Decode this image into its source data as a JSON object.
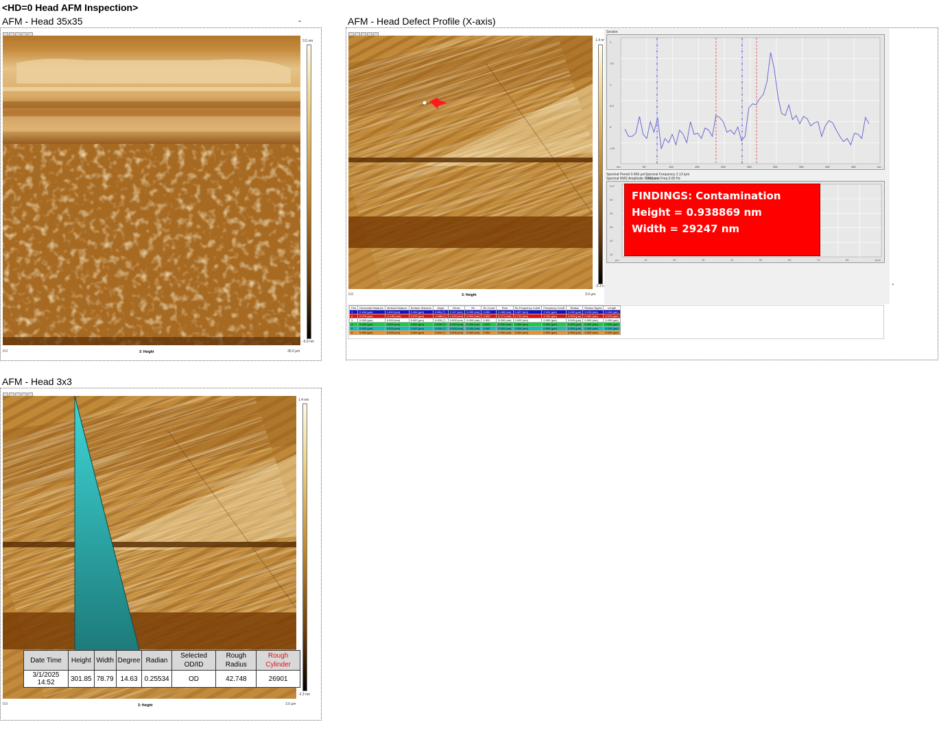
{
  "page_title": "<HD=0 Head AFM Inspection>",
  "panels": {
    "head35": {
      "title": "AFM - Head 35x35",
      "dash_mark": "-",
      "scale_top": "3.5 nm",
      "scale_bottom": "-6.9 nm",
      "x_start": "0.0",
      "x_end": "35.0 µm",
      "x_label": "3: Height"
    },
    "defect": {
      "title": "AFM - Head Defect Profile (X-axis)",
      "scale_top": "1.4 nm",
      "scale_bottom": "-2.3 nm",
      "x_start": "0.0",
      "x_end": "3.0 µm",
      "x_label": "3: Height",
      "section_label": "Section",
      "spectral_period": "Spectral Period  0.469 µm",
      "spectral_freq": "Spectral Frequency  2.13 /µm",
      "spectral_rms": "Spectral RMS Amplitude  0.267 nm",
      "temporal_freq": "Temporal Freq  0.00 Hz",
      "y_ticks": [
        "1",
        "1.5",
        "1",
        "0.5",
        "0",
        "-0.5"
      ],
      "x_ticks": [
        "nm",
        "50",
        "100",
        "150",
        "200",
        "250",
        "300",
        "350",
        "400",
        "450",
        "nm"
      ],
      "psd_x_ticks": [
        "µm",
        "10",
        "20",
        "30",
        "40",
        "50",
        "60",
        "70",
        "80",
        "1/µm"
      ],
      "psd_y_ticks": [
        "nm²",
        "50",
        "40",
        "30",
        "20",
        "10"
      ],
      "profile_y": [
        -0.35,
        -0.7,
        -0.7,
        -0.55,
        0.25,
        -0.6,
        -0.8,
        0.0,
        -0.5,
        0.2,
        -1.3,
        -0.8,
        -1.0,
        -0.6,
        -1.1,
        -0.4,
        -0.6,
        -1.0,
        0.0,
        -0.6,
        -0.55,
        -0.8,
        -0.3,
        -0.4,
        -0.7,
        0.3,
        0.2,
        0.0,
        -0.5,
        -0.4,
        -0.6,
        -0.25,
        -0.9,
        -0.7,
        0.65,
        0.85,
        0.8,
        1.1,
        1.3,
        1.9,
        3.3,
        2.5,
        1.2,
        0.4,
        0.3,
        0.8,
        0.1,
        0.3,
        -0.1,
        0.25,
        0.15,
        -0.2,
        -0.05,
        0.0,
        -0.7,
        -0.2,
        0.05,
        -0.05,
        -0.4,
        -0.7,
        -0.95,
        -0.8,
        -1.1,
        -0.55,
        -0.6,
        -0.8,
        0.2,
        -0.1
      ],
      "findings": {
        "line1": "FINDINGS: Contamination",
        "line2": "Height = 0.938869 nm",
        "line3": "Width = 29247 nm"
      },
      "table_headers": [
        "Pair",
        "Horizontal Distance",
        "Vertical Distance",
        "Surface Distance",
        "Angle",
        "Rmax",
        "Rz",
        "Rz Count",
        "Rms",
        "Ra Frequency Cutoff",
        "Frequency Cutoff",
        "Radius",
        "Radius Sigma",
        "Length"
      ],
      "table_rows": [
        [
          "1",
          "0.164 (µm)",
          "1.610 (nm)",
          "0.164 (µm)",
          "0.564 (°)",
          "2.117 (nm)",
          "0.000 (nm)",
          "0.000",
          "0.168 (nm)",
          "0.407 (nm)",
          "2.131 (µm)",
          "2.492 (µm)",
          "0.215 (nm)",
          "0.164 (µm)"
        ],
        [
          "2",
          "0.076 (µm)",
          "-0.105 (nm)",
          "0.076 (µm)",
          "-0.586 (°)",
          "1.020 (nm)",
          "0.000 (nm)",
          "0.000",
          "0.171 (nm)",
          "0.712 (nm)",
          "2.131 (µm)",
          "0.393 (µm)",
          "0.181 (nm)",
          "0.076 (µm)"
        ],
        [
          "3",
          "0.000 (µm)",
          "0.000 (nm)",
          "0.000 (µm)",
          "0.000 (°)",
          "0.000 (nm)",
          "0.000 (nm)",
          "0.000",
          "0.000 (nm)",
          "0.000 (nm)",
          "0.000 (µm)",
          "0.000 (µm)",
          "0.000 (nm)",
          "0.000 (µm)"
        ],
        [
          "4",
          "0.000 (µm)",
          "0.000 (nm)",
          "0.000 (µm)",
          "0.000 (°)",
          "0.000 (nm)",
          "0.000 (nm)",
          "0.000",
          "0.000 (nm)",
          "0.000 (nm)",
          "0.000 (µm)",
          "0.000 (µm)",
          "0.000 (nm)",
          "0.000 (µm)"
        ],
        [
          "5",
          "0.000 (µm)",
          "0.000 (nm)",
          "0.000 (µm)",
          "0.000 (°)",
          "0.000 (nm)",
          "0.000 (nm)",
          "0.000",
          "0.000 (nm)",
          "0.000 (nm)",
          "0.000 (µm)",
          "0.000 (µm)",
          "0.000 (nm)",
          "0.000 (µm)"
        ],
        [
          "6",
          "0.000 (µm)",
          "0.000 (nm)",
          "0.000 (µm)",
          "0.000 (°)",
          "0.000 (nm)",
          "0.000 (nm)",
          "0.000",
          "0.000 (nm)",
          "0.000 (nm)",
          "0.000 (µm)",
          "0.000 (µm)",
          "0.000 (nm)",
          "0.000 (µm)"
        ]
      ],
      "row_colors": [
        "#1010c8",
        "#e01010",
        "#ffffff",
        "#10d040",
        "#10c0c0",
        "#f09020"
      ],
      "right_dash": "-"
    },
    "head3": {
      "title": "AFM - Head 3x3",
      "scale_top": "1.4 nm",
      "scale_bottom": "-2.3 nm",
      "x_start": "0.0",
      "x_end": "3.0 µm",
      "x_label": "3: Height",
      "measure_headers": [
        "Date Time",
        "Height",
        "Width",
        "Degree",
        "Radian",
        "Selected OD/ID",
        "Rough Radius",
        "Rough Cylinder"
      ],
      "measure_values": [
        "3/1/2025 14:52",
        "301.85",
        "78.79",
        "14.63",
        "0.25534",
        "OD",
        "42.748",
        "26901"
      ]
    }
  },
  "colors": {
    "afm_light": "#f2d79a",
    "afm_mid": "#c28a38",
    "afm_dark": "#8a4e10",
    "findings_red": "#ff0000",
    "wedge_teal": "#2bb5b5",
    "profile_line": "#6a6ad0"
  }
}
